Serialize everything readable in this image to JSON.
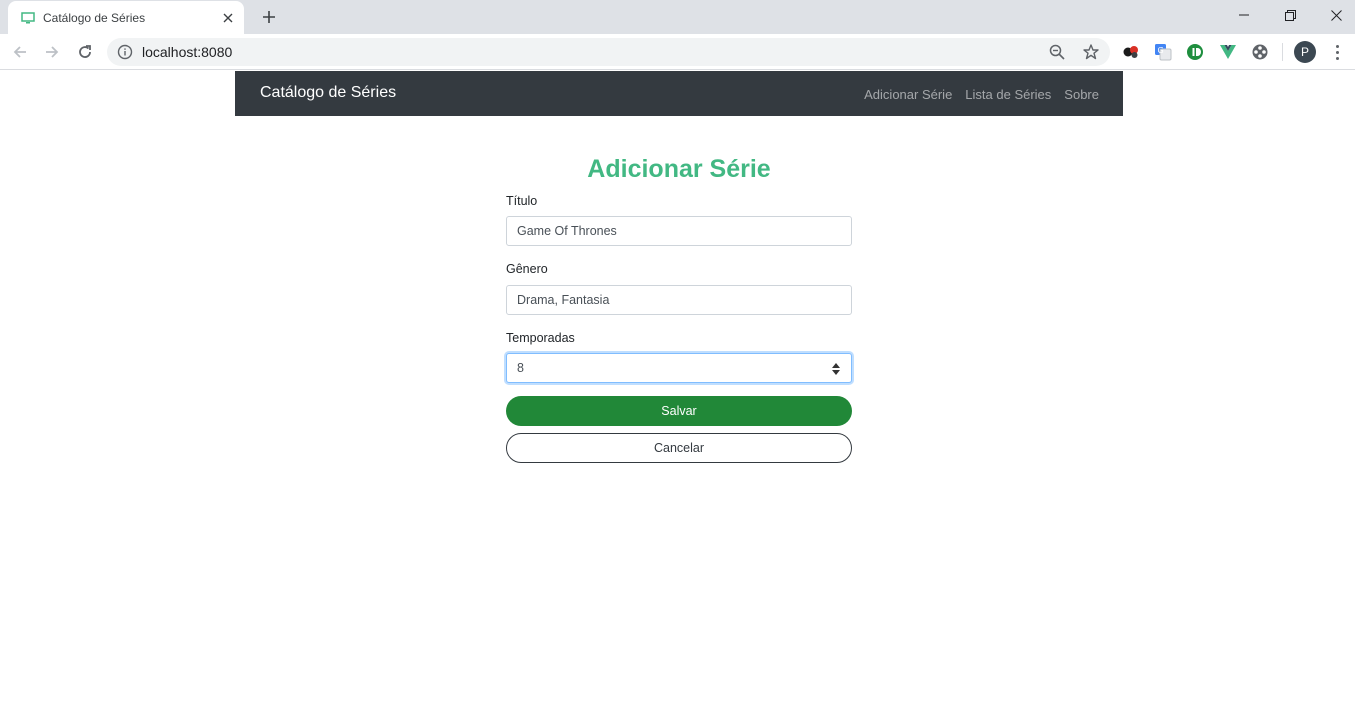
{
  "browser": {
    "tab_title": "Catálogo de Séries",
    "url": "localhost:8080",
    "profile_initial": "P"
  },
  "navbar": {
    "brand": "Catálogo de Séries",
    "links": [
      "Adicionar Série",
      "Lista de Séries",
      "Sobre"
    ]
  },
  "form": {
    "heading": "Adicionar Série",
    "titulo_label": "Título",
    "titulo_value": "Game Of Thrones",
    "genero_label": "Gênero",
    "genero_value": "Drama, Fantasia",
    "temporadas_label": "Temporadas",
    "temporadas_value": "8",
    "save_label": "Salvar",
    "cancel_label": "Cancelar"
  },
  "colors": {
    "accent": "#42b883",
    "navbar_bg": "#343a40",
    "save_bg": "#218838"
  }
}
